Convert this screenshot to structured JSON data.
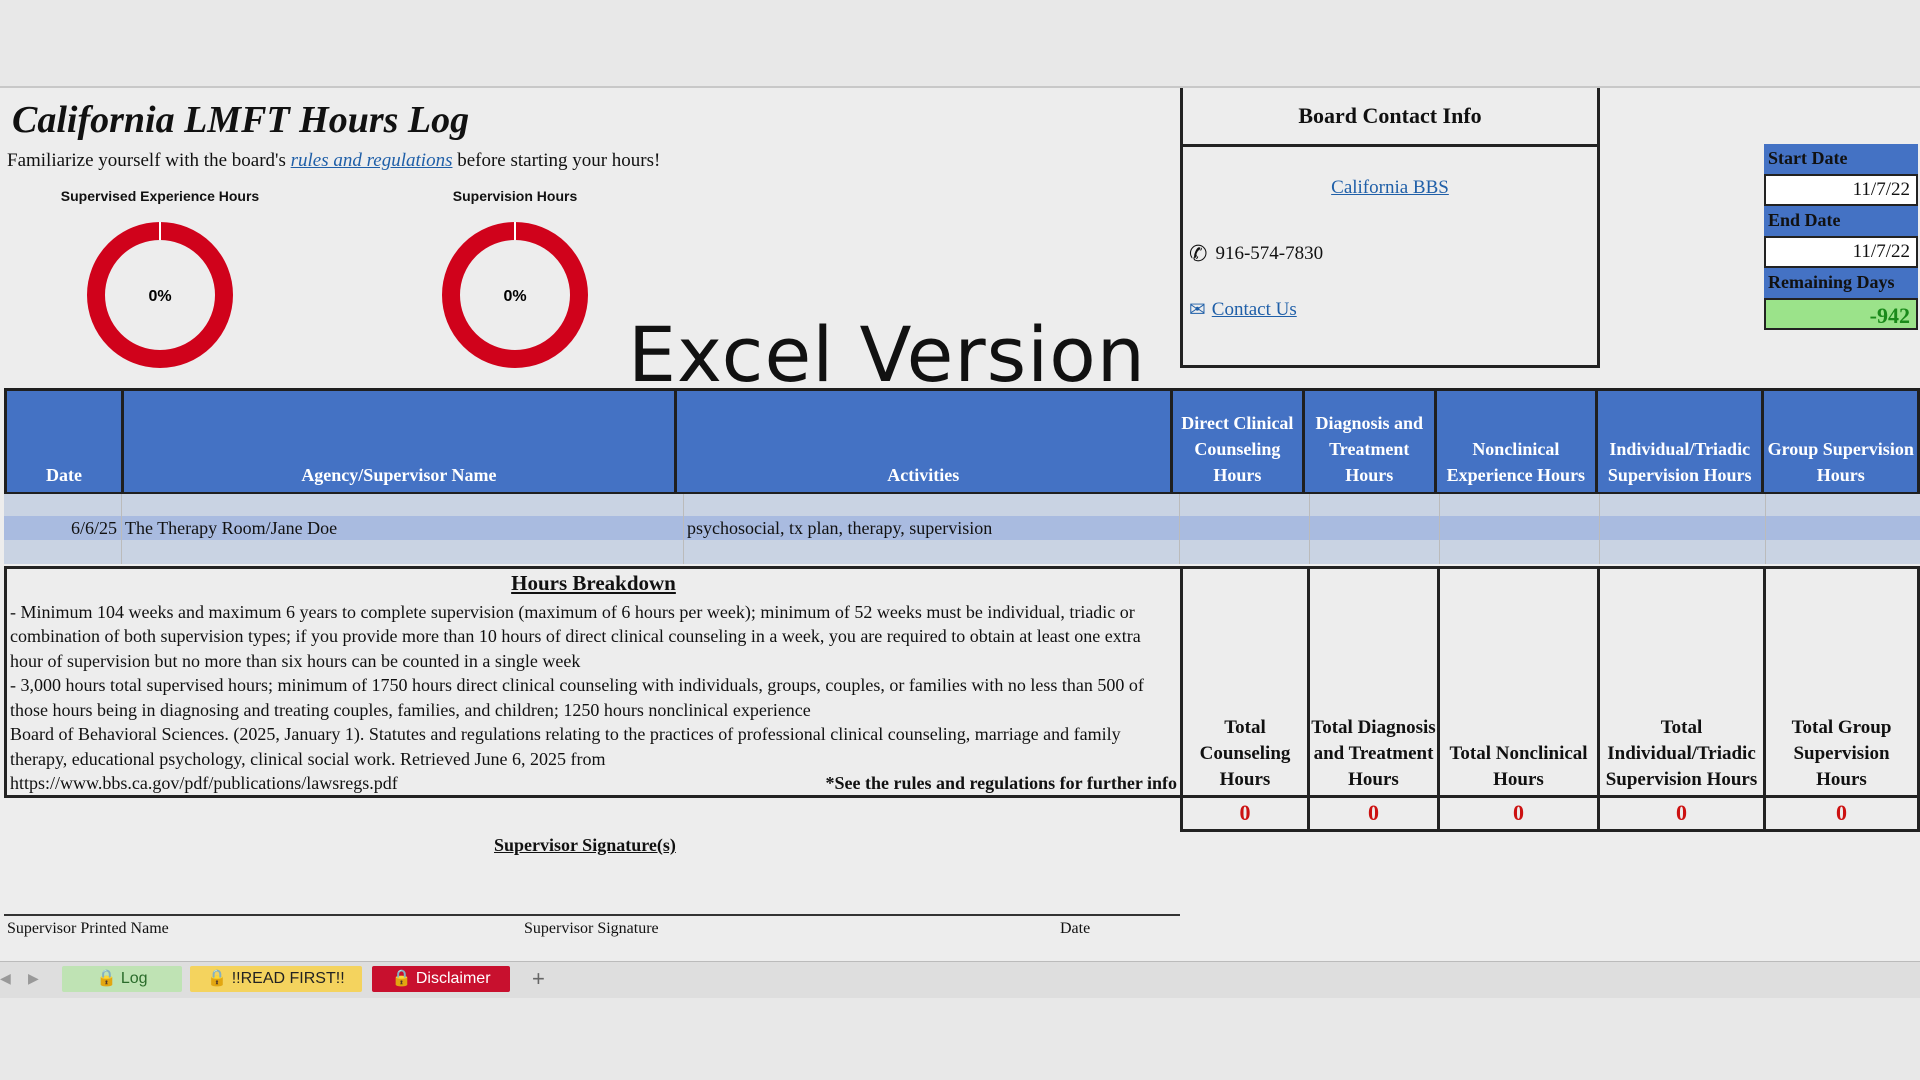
{
  "title": "California LMFT Hours Log",
  "intro": {
    "before": "Familiarize yourself with the board's ",
    "link": "rules and regulations",
    "after": " before starting your hours!"
  },
  "gauges": [
    {
      "label": "Supervised Experience Hours",
      "percent_text": "0%",
      "fill": 0
    },
    {
      "label": "Supervision Hours",
      "percent_text": "0%",
      "fill": 0
    }
  ],
  "overlay_text": "Excel Version",
  "contact": {
    "header": "Board Contact Info",
    "bbs_link": "California BBS",
    "phone": "916-574-7830",
    "contact_link": "Contact Us"
  },
  "dates": {
    "start_label": "Start Date",
    "start_value": "11/7/22",
    "end_label": "End Date",
    "end_value": "11/7/22",
    "remaining_label": "Remaining Days",
    "remaining_value": "-942"
  },
  "table": {
    "headers": [
      "Date",
      "Agency/Supervisor Name",
      "Activities",
      "Direct Clinical Counseling Hours",
      "Diagnosis and Treatment Hours",
      "Nonclinical Experience Hours",
      "Individual/Triadic Supervision Hours",
      "Group Supervision Hours"
    ],
    "row": {
      "date": "6/6/25",
      "agency": "The Therapy Room/Jane Doe",
      "activities": "psychosocial, tx plan, therapy, supervision"
    }
  },
  "breakdown": {
    "heading": "Hours Breakdown",
    "line1": "- Minimum 104 weeks and maximum 6 years to complete supervision (maximum of 6 hours per week); minimum of 52 weeks must be individual, triadic or combination of both supervision types; if you provide more than 10 hours of direct clinical counseling in a week, you are required to obtain at least one extra hour of supervision but no more than six hours can be counted in a single week",
    "line2": "- 3,000 hours total supervised hours; minimum of 1750 hours direct clinical counseling with individuals, groups, couples, or families with no less than 500 of those hours being in diagnosing and treating couples, families, and children; 1250 hours nonclinical experience",
    "citation": "Board of Behavioral Sciences. (2025, January 1). Statutes and regulations relating to the practices of professional clinical counseling, marriage and family therapy, educational psychology, clinical social work. Retrieved June 6, 2025 from",
    "url": "https://www.bbs.ca.gov/pdf/publications/lawsregs.pdf",
    "note": "*See the rules and regulations for further info"
  },
  "totals": [
    {
      "label": "Total Counseling Hours",
      "value": "0"
    },
    {
      "label": "Total Diagnosis and Treatment Hours",
      "value": "0"
    },
    {
      "label": "Total Nonclinical Hours",
      "value": "0"
    },
    {
      "label": "Total Individual/Triadic Supervision Hours",
      "value": "0"
    },
    {
      "label": "Total Group Supervision Hours",
      "value": "0"
    }
  ],
  "signature": {
    "title": "Supervisor Signature(s)",
    "printed_name": "Supervisor Printed Name",
    "signature": "Supervisor Signature",
    "date": "Date"
  },
  "tabs": [
    {
      "label": "Log",
      "color": "#bfe3b4"
    },
    {
      "label": "!!READ FIRST!!",
      "color": "#f4d35e"
    },
    {
      "label": "Disclaimer",
      "color": "#c8102e"
    }
  ],
  "colors": {
    "header_blue": "#4472c4",
    "gauge_red": "#d0021b",
    "total_red": "#cc1111"
  }
}
